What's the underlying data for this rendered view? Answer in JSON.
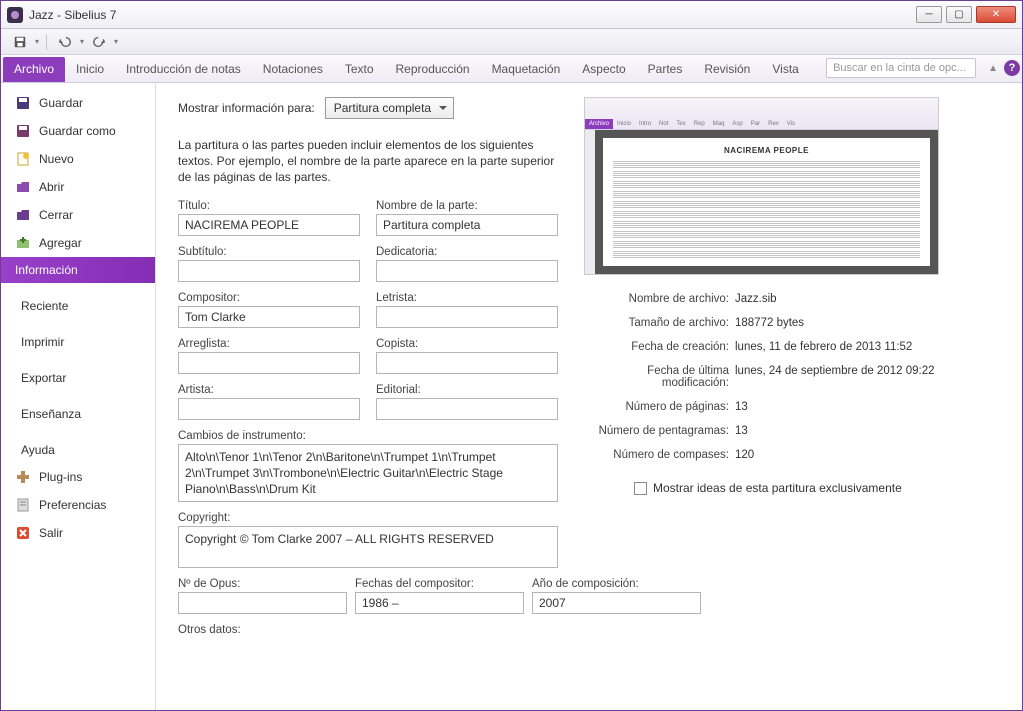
{
  "window": {
    "title": "Jazz - Sibelius 7"
  },
  "ribbon": {
    "tabs": [
      "Archivo",
      "Inicio",
      "Introducción de notas",
      "Notaciones",
      "Texto",
      "Reproducción",
      "Maquetación",
      "Aspecto",
      "Partes",
      "Revisión",
      "Vista"
    ],
    "search_placeholder": "Buscar en la cinta de opc..."
  },
  "sidebar": {
    "items": [
      {
        "label": "Guardar",
        "icon": "save"
      },
      {
        "label": "Guardar como",
        "icon": "save-as"
      },
      {
        "label": "Nuevo",
        "icon": "new"
      },
      {
        "label": "Abrir",
        "icon": "open"
      },
      {
        "label": "Cerrar",
        "icon": "close-folder"
      },
      {
        "label": "Agregar",
        "icon": "add"
      }
    ],
    "selected": "Información",
    "plain": [
      "Reciente",
      "Imprimir",
      "Exportar",
      "Enseñanza",
      "Ayuda"
    ],
    "footer": [
      {
        "label": "Plug-ins",
        "icon": "plugin"
      },
      {
        "label": "Preferencias",
        "icon": "prefs"
      },
      {
        "label": "Salir",
        "icon": "exit"
      }
    ]
  },
  "form": {
    "show_label": "Mostrar información para:",
    "show_value": "Partitura completa",
    "explanation": "La partitura o las partes pueden incluir elementos de los siguientes textos. Por ejemplo, el nombre de la parte aparece en la parte superior de las páginas de las partes.",
    "labels": {
      "titulo": "Título:",
      "nombre_parte": "Nombre de la parte:",
      "subtitulo": "Subtítulo:",
      "dedicatoria": "Dedicatoria:",
      "compositor": "Compositor:",
      "letrista": "Letrista:",
      "arreglista": "Arreglista:",
      "copista": "Copista:",
      "artista": "Artista:",
      "editorial": "Editorial:",
      "cambios": "Cambios de instrumento:",
      "copyright": "Copyright:",
      "opus": "Nº de Opus:",
      "fechas_comp": "Fechas del compositor:",
      "ano_comp": "Año de composición:",
      "otros": "Otros datos:"
    },
    "values": {
      "titulo": "NACIREMA PEOPLE",
      "nombre_parte": "Partitura completa",
      "subtitulo": "",
      "dedicatoria": "",
      "compositor": "Tom Clarke",
      "letrista": "",
      "arreglista": "",
      "copista": "",
      "artista": "",
      "editorial": "",
      "cambios": "Alto\\n\\Tenor 1\\n\\Tenor 2\\n\\Baritone\\n\\Trumpet 1\\n\\Trumpet 2\\n\\Trumpet 3\\n\\Trombone\\n\\Electric Guitar\\n\\Electric Stage Piano\\n\\Bass\\n\\Drum Kit",
      "copyright": "Copyright © Tom Clarke 2007 – ALL RIGHTS RESERVED",
      "opus": "",
      "fechas_comp": "1986 –",
      "ano_comp": "2007",
      "otros": ""
    }
  },
  "thumb": {
    "score_title": "NACIREMA PEOPLE"
  },
  "meta": {
    "labels": {
      "nombre": "Nombre de archivo:",
      "tamano": "Tamaño de archivo:",
      "creacion": "Fecha de creación:",
      "modif": "Fecha de última modificación:",
      "paginas": "Número de páginas:",
      "pentagramas": "Número de pentagramas:",
      "compases": "Número de compases:"
    },
    "values": {
      "nombre": "Jazz.sib",
      "tamano": "188772 bytes",
      "creacion": "lunes, 11 de febrero de 2013 11:52",
      "modif": "lunes, 24 de septiembre de 2012 09:22",
      "paginas": "13",
      "pentagramas": "13",
      "compases": "120"
    },
    "checkbox_label": "Mostrar ideas de esta partitura exclusivamente"
  }
}
